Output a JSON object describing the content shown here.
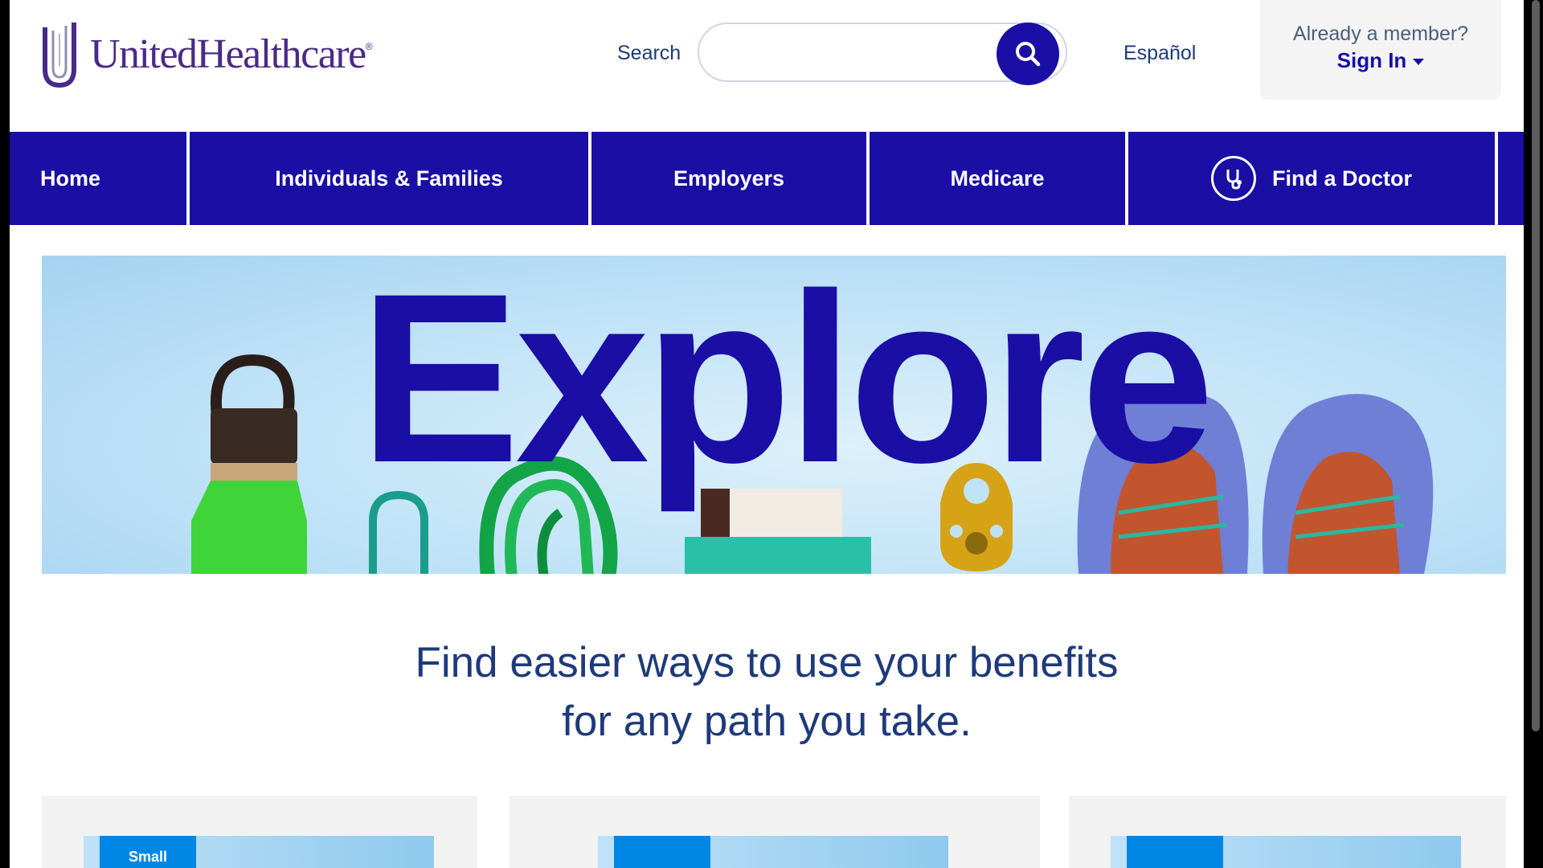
{
  "header": {
    "logo_text": "UnitedHealthcare",
    "search_label": "Search",
    "search_placeholder": "",
    "language_link": "Español",
    "signin_question": "Already a member?",
    "signin_label": "Sign In"
  },
  "nav": {
    "items": [
      {
        "label": "Home"
      },
      {
        "label": "Individuals & Families"
      },
      {
        "label": "Employers"
      },
      {
        "label": "Medicare"
      },
      {
        "label": "Find a Doctor"
      }
    ]
  },
  "hero": {
    "word": "Explore"
  },
  "main": {
    "headline_line1": "Find easier ways to use your benefits",
    "headline_line2": "for any path you take."
  },
  "cards": [
    {
      "tab_label": "Small"
    },
    {
      "tab_label": ""
    },
    {
      "tab_label": ""
    }
  ],
  "colors": {
    "brand_blue": "#1a0ea5",
    "brand_purple": "#4a2a86",
    "text_navy": "#1e3a7b"
  }
}
